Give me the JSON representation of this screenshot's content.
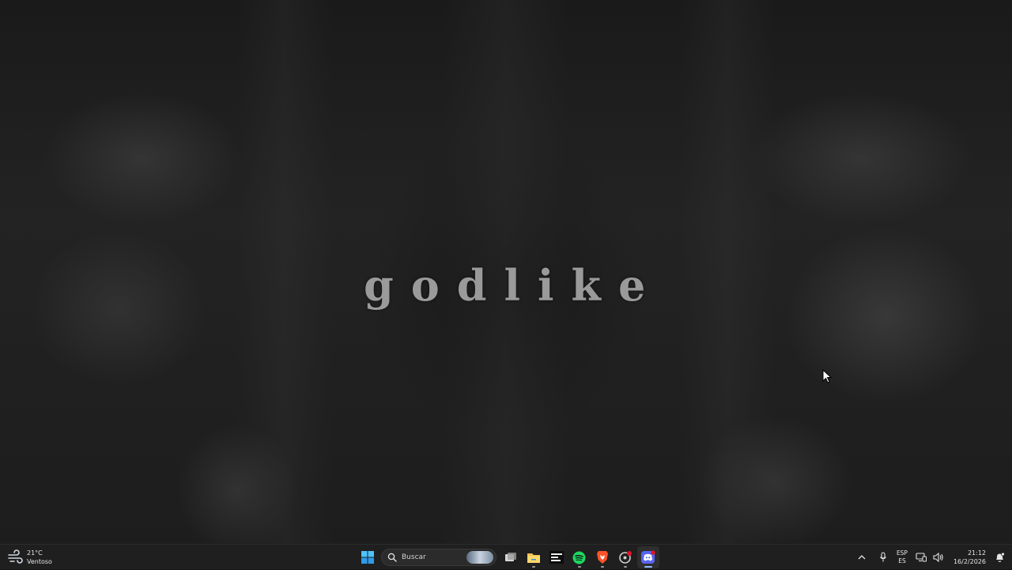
{
  "wallpaper": {
    "text": "godlike"
  },
  "taskbar": {
    "weather": {
      "temperature": "21°C",
      "condition": "Ventoso",
      "icon": "windy-weather-icon"
    },
    "start_icon": "windows-start-icon",
    "search": {
      "label": "Buscar",
      "icon": "search-icon"
    },
    "apps": [
      {
        "name": "task-view",
        "icon": "task-view-icon"
      },
      {
        "name": "file-explorer",
        "icon": "folder-icon"
      },
      {
        "name": "chill-beats",
        "icon": "chill-beats-icon"
      },
      {
        "name": "spotify",
        "icon": "spotify-icon"
      },
      {
        "name": "brave",
        "icon": "brave-icon"
      },
      {
        "name": "app-with-badge",
        "icon": "circle-app-icon"
      },
      {
        "name": "discord",
        "icon": "discord-icon",
        "active": true
      }
    ],
    "tray": {
      "chevron_icon": "chevron-up-icon",
      "mic_icon": "microphone-icon",
      "language_top": "ESP",
      "language_bottom": "ES",
      "network_icon": "network-icon",
      "volume_icon": "speaker-icon",
      "time": "21:12",
      "date": "16/2/2026",
      "notification_icon": "notification-bell-icon"
    }
  },
  "colors": {
    "taskbar_bg": "#1f1f1f",
    "accent": "#8fbaff",
    "spotify": "#1ed760",
    "brave": "#fb542b",
    "discord": "#5865f2",
    "folder": "#f4c04e"
  }
}
